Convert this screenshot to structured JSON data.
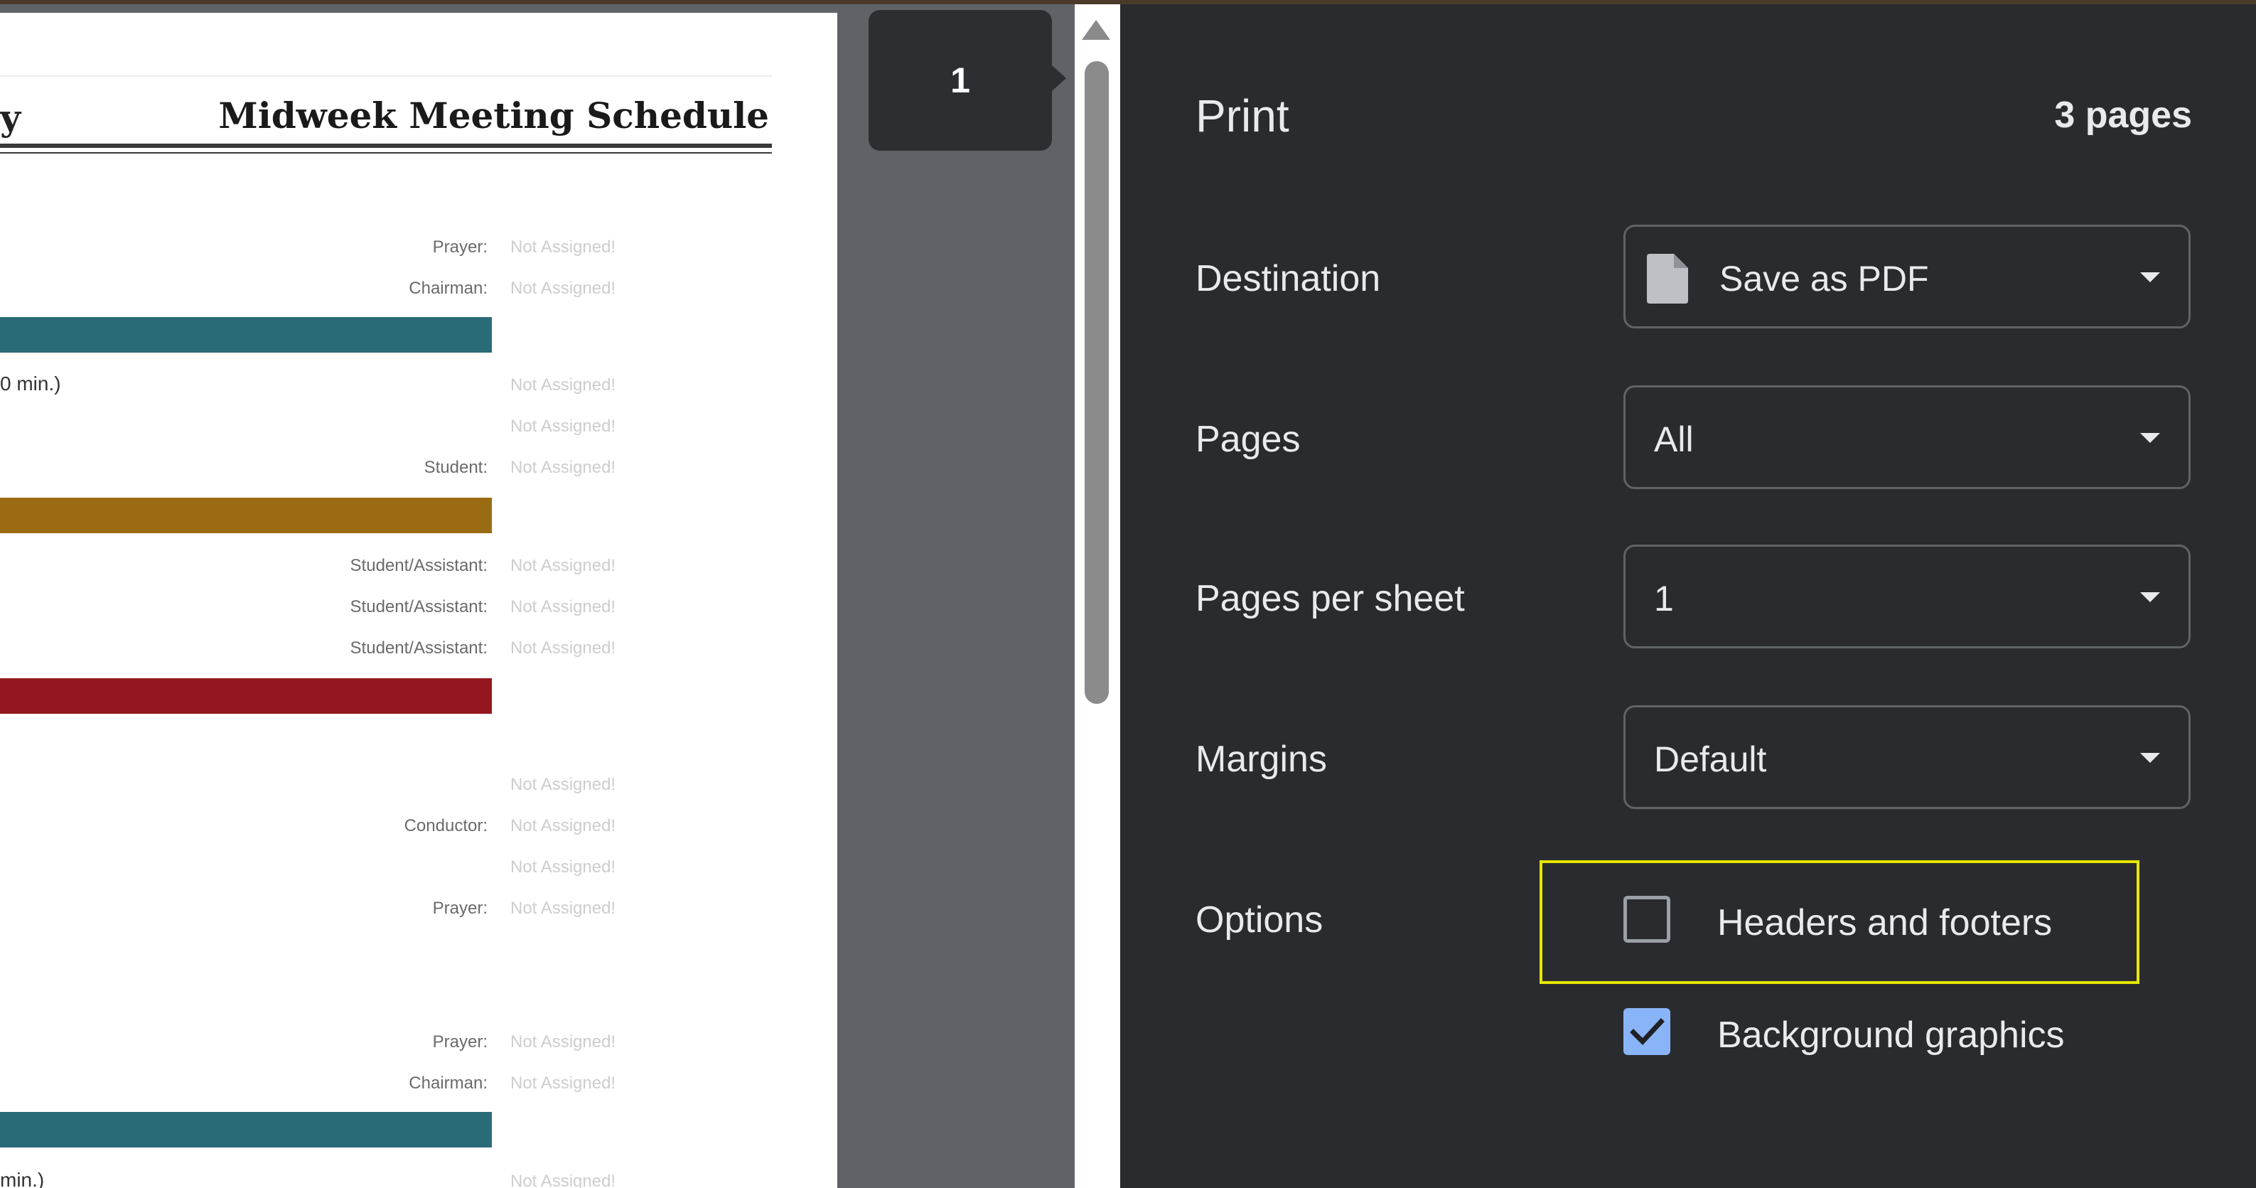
{
  "preview": {
    "heading_left": "y",
    "heading": "Midweek Meeting Schedule",
    "rows": [
      {
        "label": "Prayer:",
        "value": "Not Assigned!"
      },
      {
        "label": "Chairman:",
        "value": "Not Assigned!"
      },
      {
        "left": "0 min.)",
        "value": "Not Assigned!"
      },
      {
        "value": "Not Assigned!"
      },
      {
        "label": "Student:",
        "value": "Not Assigned!"
      },
      {
        "label": "Student/Assistant:",
        "value": "Not Assigned!"
      },
      {
        "label": "Student/Assistant:",
        "value": "Not Assigned!"
      },
      {
        "label": "Student/Assistant:",
        "value": "Not Assigned!"
      },
      {
        "value": "Not Assigned!"
      },
      {
        "label": "Conductor:",
        "value": "Not Assigned!"
      },
      {
        "value": "Not Assigned!"
      },
      {
        "label": "Prayer:",
        "value": "Not Assigned!"
      },
      {
        "label": "Prayer:",
        "value": "Not Assigned!"
      },
      {
        "label": "Chairman:",
        "value": "Not Assigned!"
      },
      {
        "left": "min.)",
        "value": "Not Assigned!"
      }
    ],
    "band_colors": {
      "teal": "#2a6b78",
      "gold": "#9b6b14",
      "red": "#941720"
    }
  },
  "thumbnail": {
    "page_number": "1"
  },
  "print": {
    "title": "Print",
    "page_count": "3 pages",
    "destination": {
      "label": "Destination",
      "value": "Save as PDF",
      "icon": "document-icon"
    },
    "pages": {
      "label": "Pages",
      "value": "All"
    },
    "pages_per_sheet": {
      "label": "Pages per sheet",
      "value": "1"
    },
    "margins": {
      "label": "Margins",
      "value": "Default"
    },
    "options": {
      "label": "Options",
      "headers_footers": {
        "label": "Headers and footers",
        "checked": false
      },
      "background_graphics": {
        "label": "Background graphics",
        "checked": true
      }
    }
  },
  "colors": {
    "accent": "#8ab4f8",
    "highlight": "#e6e600",
    "panel_bg": "#2a2b2f"
  }
}
